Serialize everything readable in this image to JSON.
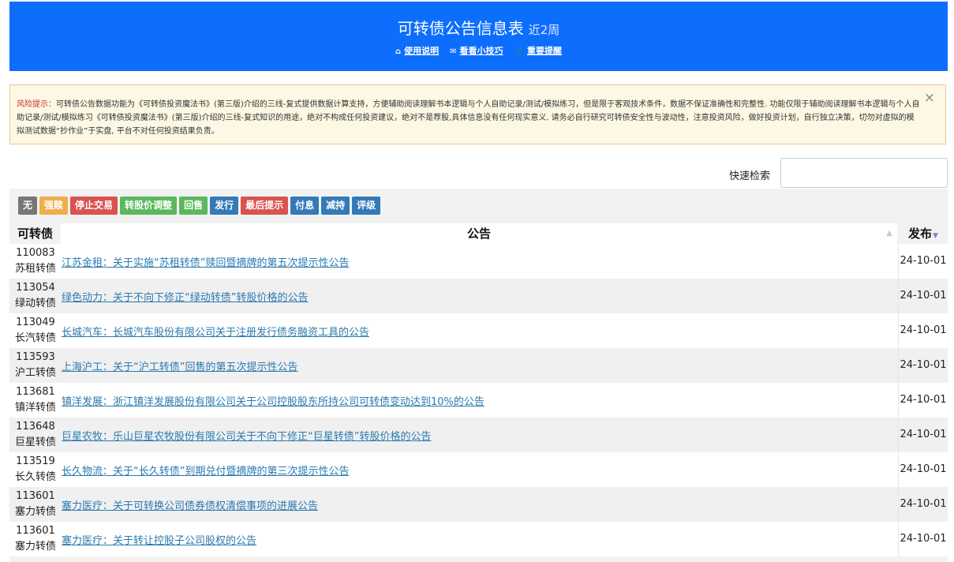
{
  "header": {
    "title": "可转债公告信息表",
    "subtitle": "近2周",
    "links": [
      {
        "icon": "home-icon",
        "glyph": "⌂",
        "label": "使用说明"
      },
      {
        "icon": "envelope-icon",
        "glyph": "✉",
        "label": "看看小技巧"
      },
      {
        "icon": "user-icon",
        "glyph": "👤",
        "label": "重要提醒"
      }
    ]
  },
  "alert": {
    "label": "风险提示：",
    "text": "可转债公告数据功能为《可转债投资魔法书》(第三版)介绍的三线-复式提供数据计算支持，方便辅助阅读理解书本逻辑与个人自助记录/测试/模拟练习，但是限于客观技术条件，数据不保证准确性和完整性. 功能仅限于辅助阅读理解书本逻辑与个人自助记录/测试/模拟练习《可转债投资魔法书》(第三版)介绍的三线-复式知识的用途，绝对不构成任何投资建议，绝对不是荐股,具体信息没有任何现实意义. 请务必自行研究可转债安全性与波动性，注意投资风险，做好投资计划，自行独立决策，切勿对虚拟的模拟测试数据“抄作业”于实盘, 平台不对任何投资结果负责。",
    "close": "×"
  },
  "search": {
    "label": "快速检索",
    "placeholder": "",
    "value": ""
  },
  "filters": [
    {
      "label": "无",
      "color": "#777777"
    },
    {
      "label": "强赎",
      "color": "#f0ad4e"
    },
    {
      "label": "停止交易",
      "color": "#d9534f"
    },
    {
      "label": "转股价调整",
      "color": "#5cb85c"
    },
    {
      "label": "回售",
      "color": "#5cb85c"
    },
    {
      "label": "发行",
      "color": "#337ab7"
    },
    {
      "label": "最后提示",
      "color": "#d9534f"
    },
    {
      "label": "付息",
      "color": "#337ab7"
    },
    {
      "label": "减持",
      "color": "#337ab7"
    },
    {
      "label": "评级",
      "color": "#337ab7"
    }
  ],
  "table": {
    "columns": {
      "code": "可转债",
      "announcement": "公告",
      "date": "发布"
    },
    "sort_indicator": "▼",
    "rows": [
      {
        "code": "110083",
        "name": "苏租转债",
        "announcement": "江苏金租：关于实施“苏租转债”赎回暨摘牌的第五次提示性公告",
        "date": "24-10-01"
      },
      {
        "code": "113054",
        "name": "绿动转债",
        "announcement": "绿色动力：关于不向下修正“绿动转债”转股价格的公告",
        "date": "24-10-01"
      },
      {
        "code": "113049",
        "name": "长汽转债",
        "announcement": "长城汽车：长城汽车股份有限公司关于注册发行债务融资工具的公告",
        "date": "24-10-01"
      },
      {
        "code": "113593",
        "name": "沪工转债",
        "announcement": "上海沪工：关于“沪工转债”回售的第五次提示性公告",
        "date": "24-10-01"
      },
      {
        "code": "113681",
        "name": "镇洋转债",
        "announcement": "镇洋发展：浙江镇洋发展股份有限公司关于公司控股股东所持公司可转债变动达到10%的公告",
        "date": "24-10-01"
      },
      {
        "code": "113648",
        "name": "巨星转债",
        "announcement": "巨星农牧：乐山巨星农牧股份有限公司关于不向下修正“巨星转债”转股价格的公告",
        "date": "24-10-01"
      },
      {
        "code": "113519",
        "name": "长久转债",
        "announcement": "长久物流：关于“长久转债”到期兑付暨摘牌的第三次提示性公告",
        "date": "24-10-01"
      },
      {
        "code": "113601",
        "name": "塞力转债",
        "announcement": "塞力医疗：关于可转换公司债券债权清偿事项的进展公告",
        "date": "24-10-01"
      },
      {
        "code": "113601",
        "name": "塞力转债",
        "announcement": "塞力医疗：关于转让控股子公司股权的公告",
        "date": "24-10-01"
      }
    ]
  }
}
